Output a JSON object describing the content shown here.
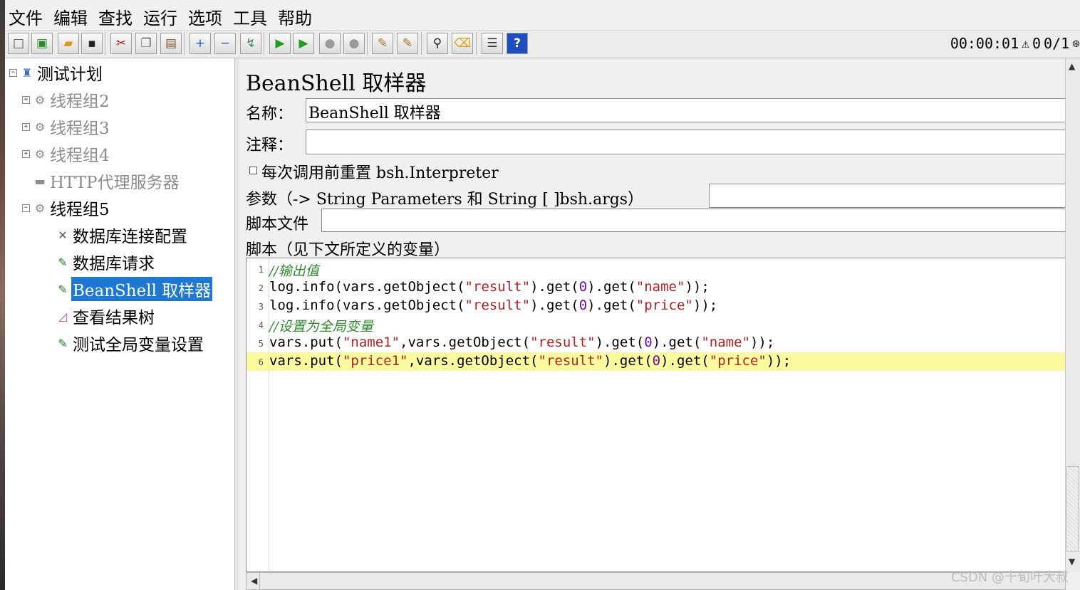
{
  "menu": [
    "文件",
    "编辑",
    "查找",
    "运行",
    "选项",
    "工具",
    "帮助"
  ],
  "toolbar": {
    "buttons": [
      {
        "name": "new-icon",
        "glyph": "□",
        "color": "#555"
      },
      {
        "name": "templates-icon",
        "glyph": "▣",
        "color": "#2a8a2a"
      },
      {
        "name": "open-icon",
        "glyph": "▰",
        "color": "#d69a10"
      },
      {
        "name": "save-icon",
        "glyph": "▪",
        "color": "#222"
      },
      {
        "name": "cut-icon",
        "glyph": "✂",
        "color": "#c01818"
      },
      {
        "name": "copy-icon",
        "glyph": "❐",
        "color": "#666"
      },
      {
        "name": "paste-icon",
        "glyph": "▤",
        "color": "#7a5a2a"
      },
      {
        "name": "expand-icon",
        "glyph": "+",
        "color": "#1f5fbf"
      },
      {
        "name": "collapse-icon",
        "glyph": "−",
        "color": "#1f5fbf"
      },
      {
        "name": "toggle-icon",
        "glyph": "↯",
        "color": "#3a8a5a"
      },
      {
        "name": "start-icon",
        "glyph": "▶",
        "color": "#1e9e1e"
      },
      {
        "name": "start-no-pause-icon",
        "glyph": "▶",
        "color": "#1e9e1e"
      },
      {
        "name": "stop-icon",
        "glyph": "●",
        "color": "#9a9a9a"
      },
      {
        "name": "shutdown-icon",
        "glyph": "●",
        "color": "#9a9a9a"
      },
      {
        "name": "clear-icon",
        "glyph": "✎",
        "color": "#a0702a"
      },
      {
        "name": "clear-all-icon",
        "glyph": "✎",
        "color": "#a0702a"
      },
      {
        "name": "search-icon",
        "glyph": "⚲",
        "color": "#222"
      },
      {
        "name": "reset-search-icon",
        "glyph": "⌫",
        "color": "#d6a010"
      },
      {
        "name": "function-helper-icon",
        "glyph": "☰",
        "color": "#333"
      },
      {
        "name": "help-icon",
        "glyph": "?",
        "color": "#fff"
      }
    ],
    "timer": "00:00:01",
    "warning_count": "0",
    "threads": "0/1"
  },
  "tree": {
    "items": [
      {
        "label": "测试计划",
        "level": 0,
        "icon": "flask-icon",
        "expander": "⊟",
        "disabled": false,
        "selected": false
      },
      {
        "label": "线程组2",
        "level": 1,
        "icon": "gear-icon",
        "expander": "⊞",
        "disabled": true,
        "selected": false
      },
      {
        "label": "线程组3",
        "level": 1,
        "icon": "gear-icon",
        "expander": "⊞",
        "disabled": true,
        "selected": false
      },
      {
        "label": "线程组4",
        "level": 1,
        "icon": "gear-icon",
        "expander": "⊞",
        "disabled": true,
        "selected": false
      },
      {
        "label": "HTTP代理服务器",
        "level": 1,
        "icon": "proxy-icon",
        "expander": "",
        "disabled": true,
        "selected": false
      },
      {
        "label": "线程组5",
        "level": 1,
        "icon": "gear-icon",
        "expander": "⊟",
        "disabled": false,
        "selected": false
      },
      {
        "label": "数据库连接配置",
        "level": 2,
        "icon": "wrench-icon",
        "expander": "",
        "disabled": false,
        "selected": false
      },
      {
        "label": "数据库请求",
        "level": 2,
        "icon": "pencil-icon",
        "expander": "",
        "disabled": false,
        "selected": false
      },
      {
        "label": "BeanShell 取样器",
        "level": 2,
        "icon": "pencil-icon",
        "expander": "",
        "disabled": false,
        "selected": true
      },
      {
        "label": "查看结果树",
        "level": 2,
        "icon": "chart-icon",
        "expander": "",
        "disabled": false,
        "selected": false
      },
      {
        "label": "测试全局变量设置",
        "level": 2,
        "icon": "pencil-icon",
        "expander": "",
        "disabled": false,
        "selected": false
      }
    ]
  },
  "panel": {
    "title": "BeanShell 取样器",
    "name_label": "名称：",
    "name_value": "BeanShell 取样器",
    "comment_label": "注释：",
    "comment_value": "",
    "reset_checkbox_label": "每次调用前重置 bsh.Interpreter",
    "params_label": "参数（-> String Parameters 和 String [ ]bsh.args）",
    "params_value": "",
    "script_file_label": "脚本文件",
    "script_file_value": "",
    "script_label": "脚本（见下文所定义的变量）"
  },
  "script": {
    "lines": [
      {
        "num": "1",
        "text": "//输出值",
        "hl": false
      },
      {
        "num": "2",
        "text": "log.info(vars.getObject(\"result\").get(0).get(\"name\"));",
        "hl": false
      },
      {
        "num": "3",
        "text": "log.info(vars.getObject(\"result\").get(0).get(\"price\"));",
        "hl": false
      },
      {
        "num": "4",
        "text": "//设置为全局变量",
        "hl": false
      },
      {
        "num": "5",
        "text": "vars.put(\"name1\",vars.getObject(\"result\").get(0).get(\"name\"));",
        "hl": false
      },
      {
        "num": "6",
        "text": "vars.put(\"price1\",vars.getObject(\"result\").get(0).get(\"price\"));",
        "hl": true
      }
    ]
  },
  "watermark": "CSDN @十旬叶大叔"
}
